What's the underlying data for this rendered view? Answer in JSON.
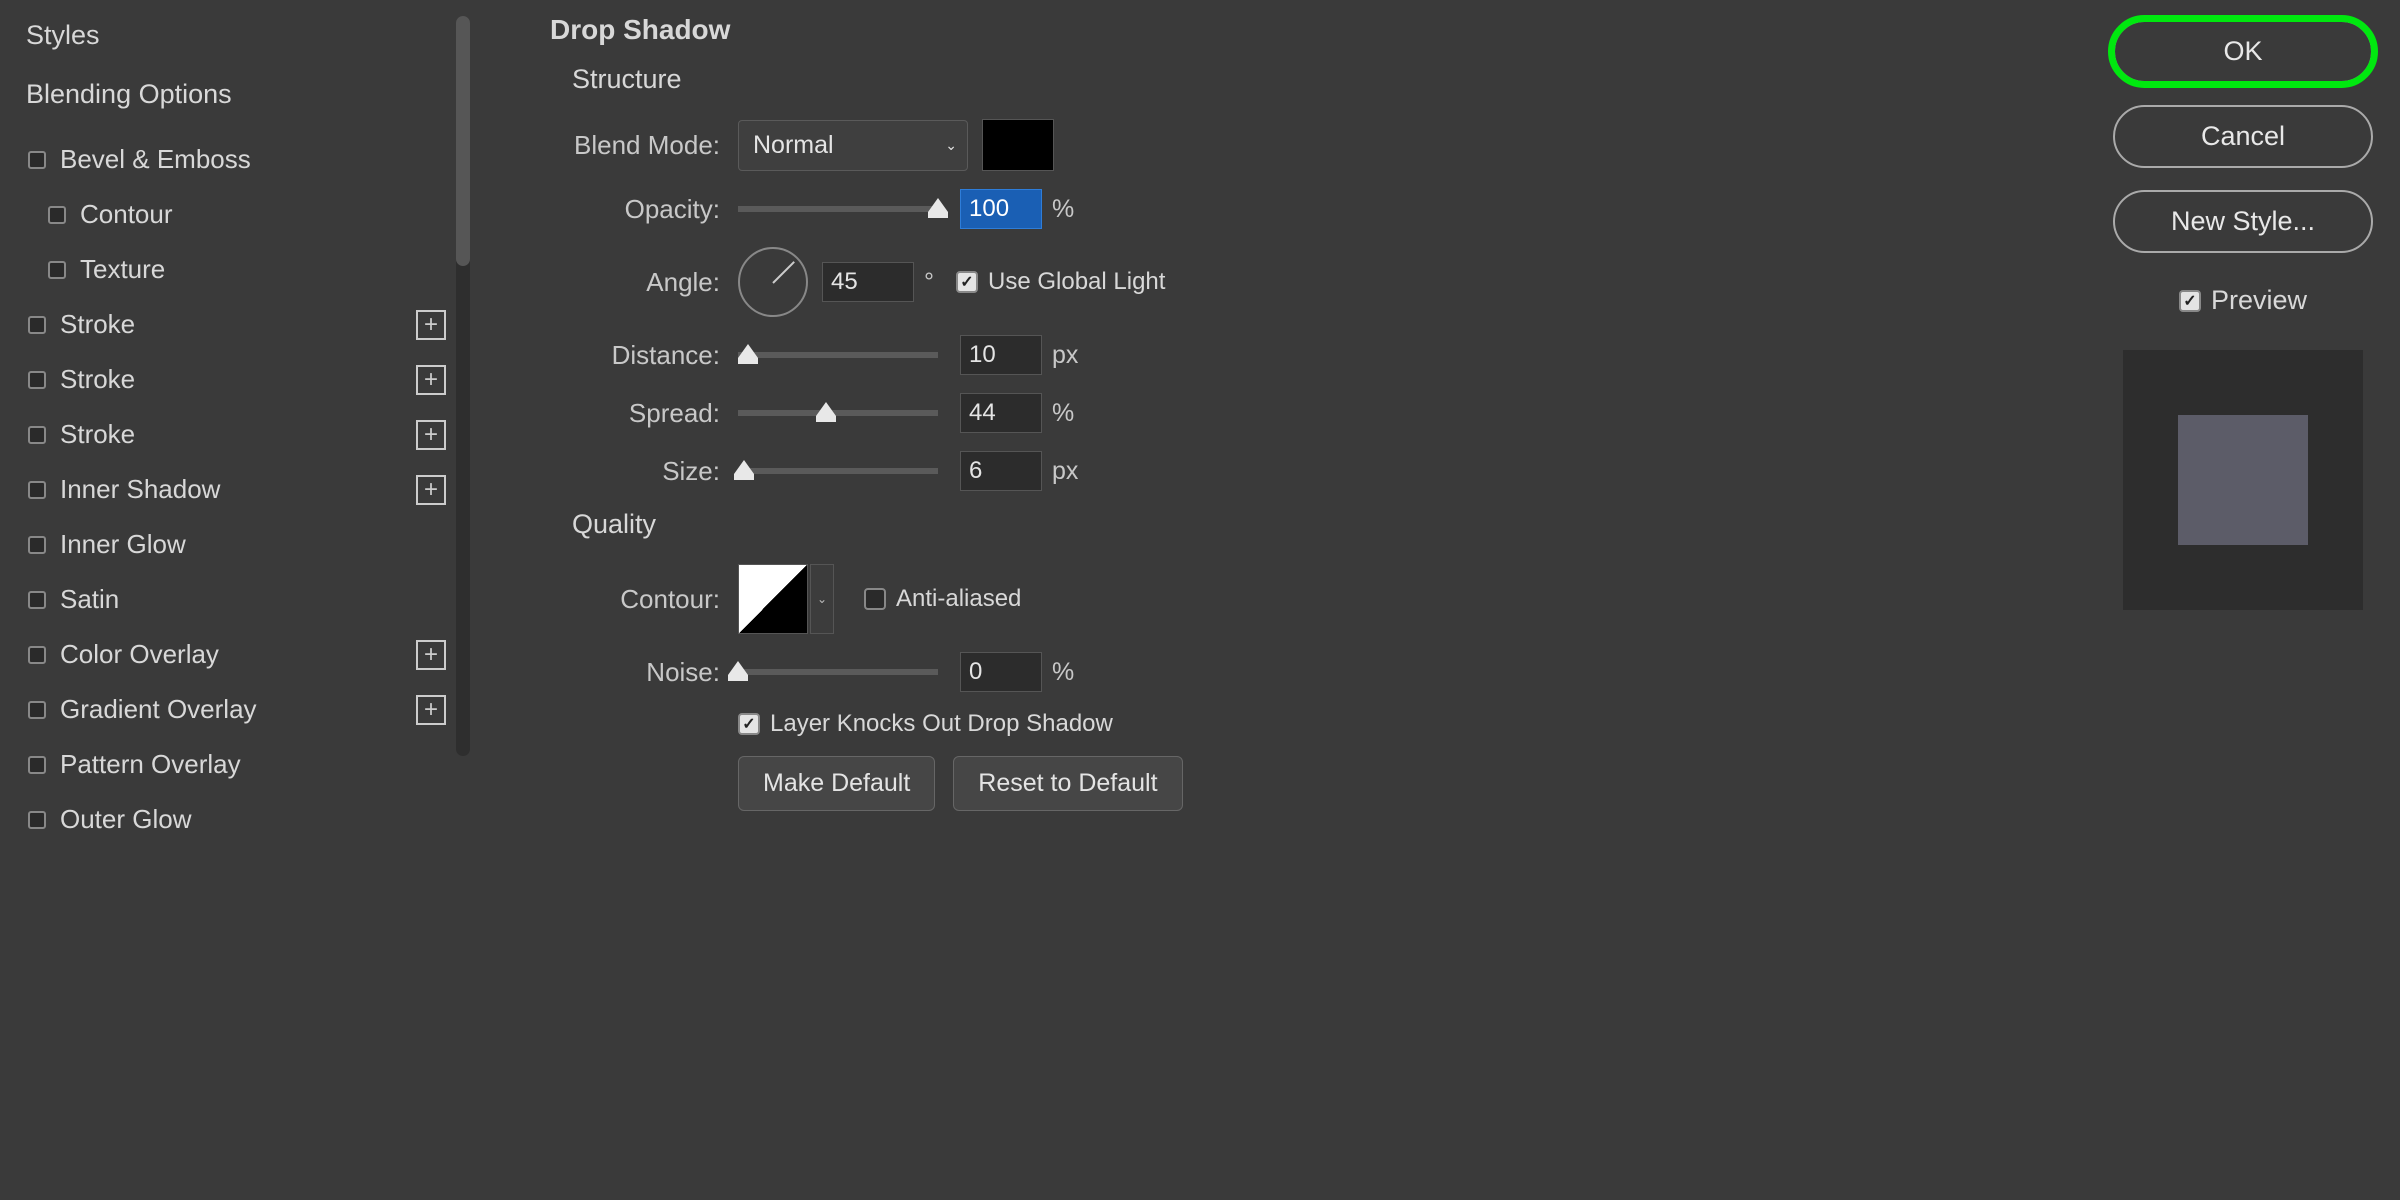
{
  "sidebar": {
    "title": "Styles",
    "blending": "Blending Options",
    "items": [
      {
        "label": "Bevel & Emboss",
        "add": false,
        "sub": false
      },
      {
        "label": "Contour",
        "add": false,
        "sub": true
      },
      {
        "label": "Texture",
        "add": false,
        "sub": true
      },
      {
        "label": "Stroke",
        "add": true,
        "sub": false
      },
      {
        "label": "Stroke",
        "add": true,
        "sub": false
      },
      {
        "label": "Stroke",
        "add": true,
        "sub": false
      },
      {
        "label": "Inner Shadow",
        "add": true,
        "sub": false
      },
      {
        "label": "Inner Glow",
        "add": false,
        "sub": false
      },
      {
        "label": "Satin",
        "add": false,
        "sub": false
      },
      {
        "label": "Color Overlay",
        "add": true,
        "sub": false
      },
      {
        "label": "Gradient Overlay",
        "add": true,
        "sub": false
      },
      {
        "label": "Pattern Overlay",
        "add": false,
        "sub": false
      },
      {
        "label": "Outer Glow",
        "add": false,
        "sub": false
      }
    ]
  },
  "main": {
    "title": "Drop Shadow",
    "structure": "Structure",
    "blend_mode_label": "Blend Mode:",
    "blend_mode_value": "Normal",
    "opacity_label": "Opacity:",
    "opacity_value": "100",
    "opacity_pct": 100,
    "angle_label": "Angle:",
    "angle_value": "45",
    "angle_unit": "°",
    "use_global_label": "Use Global Light",
    "distance_label": "Distance:",
    "distance_value": "10",
    "distance_pct": 5,
    "spread_label": "Spread:",
    "spread_value": "44",
    "spread_pct": 44,
    "size_label": "Size:",
    "size_value": "6",
    "size_pct": 3,
    "px": "px",
    "pct": "%",
    "quality": "Quality",
    "contour_label": "Contour:",
    "anti_label": "Anti-aliased",
    "noise_label": "Noise:",
    "noise_value": "0",
    "noise_pct": 0,
    "knockout_label": "Layer Knocks Out Drop Shadow",
    "make_default": "Make Default",
    "reset_default": "Reset to Default"
  },
  "right": {
    "ok": "OK",
    "cancel": "Cancel",
    "new_style": "New Style...",
    "preview": "Preview"
  }
}
